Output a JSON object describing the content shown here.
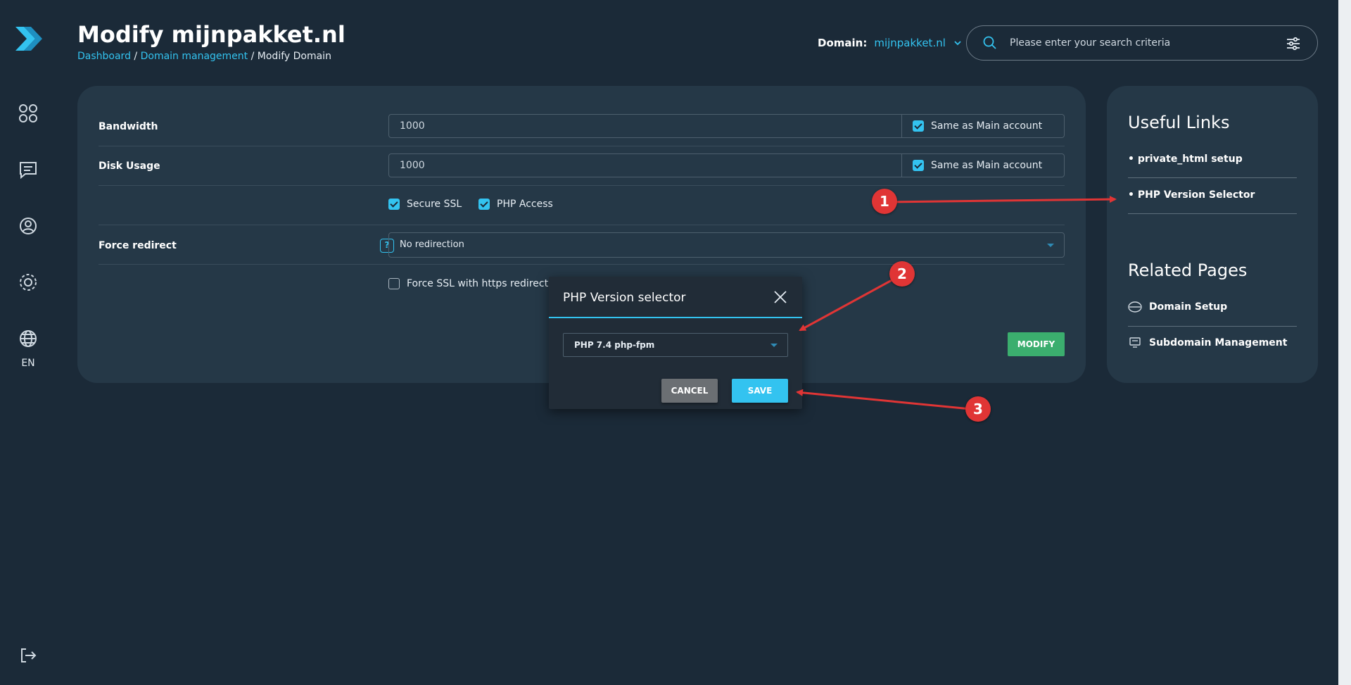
{
  "sidebar": {
    "lang": "EN",
    "icons": [
      "logo-icon",
      "dashboard-icon",
      "messages-icon",
      "account-icon",
      "settings-icon",
      "globe-icon",
      "logout-icon"
    ]
  },
  "header": {
    "title": "Modify mijnpakket.nl",
    "breadcrumb": {
      "home": "Dashboard",
      "sep1": " / ",
      "parent": "Domain management",
      "sep2": " / ",
      "current": "Modify Domain"
    },
    "domain_label": "Domain:",
    "domain_value": "mijnpakket.nl",
    "search_placeholder": "Please enter your search criteria"
  },
  "form": {
    "bandwidth": {
      "label": "Bandwidth",
      "value": "1000",
      "same_label": "Same as Main account",
      "same_checked": true
    },
    "disk": {
      "label": "Disk Usage",
      "value": "1000",
      "same_label": "Same as Main account",
      "same_checked": true
    },
    "secure_ssl": {
      "label": "Secure SSL",
      "checked": true
    },
    "php_access": {
      "label": "PHP Access",
      "checked": true
    },
    "force_redirect": {
      "label": "Force redirect",
      "help": "?",
      "value": "No redirection"
    },
    "force_ssl": {
      "label": "Force SSL with https redirect",
      "checked": false
    },
    "modify_label": "MODIFY"
  },
  "useful_links": {
    "title": "Useful Links",
    "items": [
      "• private_html setup",
      "• PHP Version Selector"
    ]
  },
  "related_pages": {
    "title": "Related Pages",
    "items": [
      "Domain Setup",
      "Subdomain Management"
    ]
  },
  "modal": {
    "title": "PHP Version selector",
    "selected": "PHP 7.4 php-fpm",
    "cancel_label": "CANCEL",
    "save_label": "SAVE"
  },
  "annotations": [
    "1",
    "2",
    "3"
  ],
  "colors": {
    "background": "#1b2a38",
    "card": "#253847",
    "accent": "#33c3f0",
    "modify": "#3bae6e",
    "annotation": "#e03535"
  }
}
